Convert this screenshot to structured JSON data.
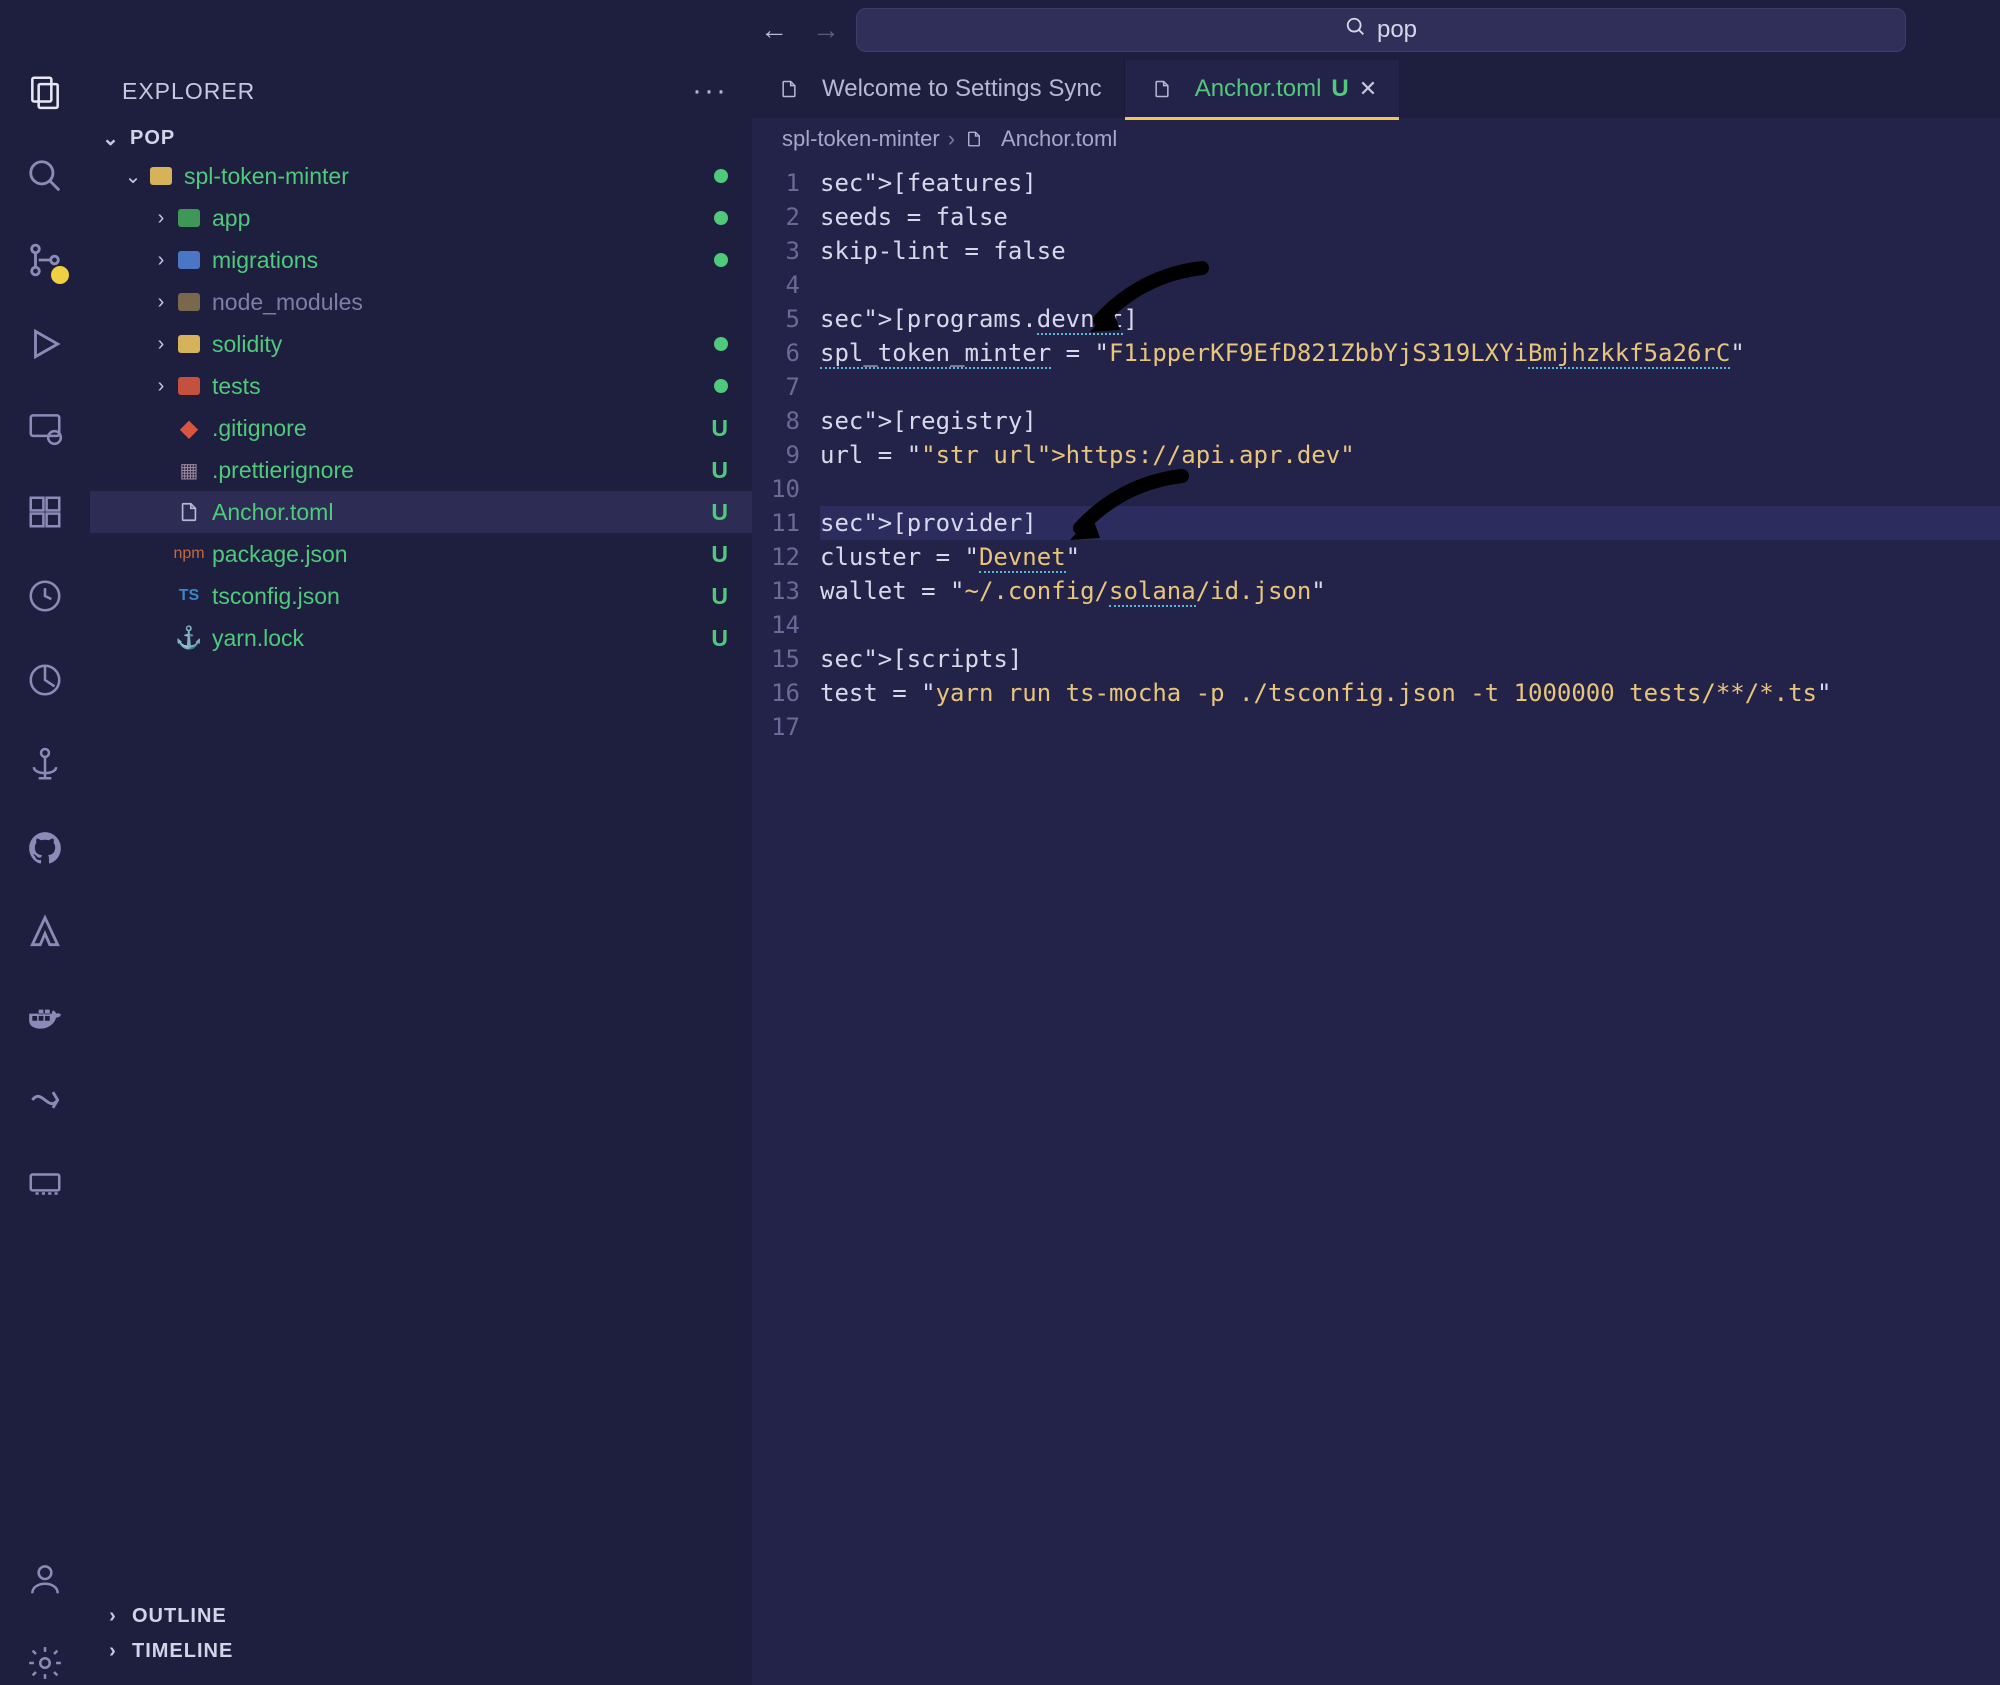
{
  "titlebar": {
    "search_value": "pop"
  },
  "sidebar": {
    "header": "EXPLORER",
    "section": "POP",
    "project": "spl-token-minter",
    "folders": [
      {
        "name": "app",
        "kind": "folder-green",
        "dot": true
      },
      {
        "name": "migrations",
        "kind": "folder-blue",
        "dot": true
      },
      {
        "name": "node_modules",
        "kind": "folder-yellow",
        "muted": true
      },
      {
        "name": "solidity",
        "kind": "folder-yellow",
        "dot": true
      },
      {
        "name": "tests",
        "kind": "folder-red",
        "dot": true
      }
    ],
    "files": [
      {
        "name": ".gitignore",
        "icon": "git",
        "u": true
      },
      {
        "name": ".prettierignore",
        "icon": "prettier",
        "u": true
      },
      {
        "name": "Anchor.toml",
        "icon": "file",
        "u": true,
        "selected": true
      },
      {
        "name": "package.json",
        "icon": "json",
        "u": true
      },
      {
        "name": "tsconfig.json",
        "icon": "ts",
        "u": true
      },
      {
        "name": "yarn.lock",
        "icon": "yarn",
        "u": true
      }
    ],
    "outline": "OUTLINE",
    "timeline": "TIMELINE"
  },
  "tabs": [
    {
      "label": "Welcome to Settings Sync",
      "active": false
    },
    {
      "label": "Anchor.toml",
      "modified": "U",
      "active": true
    }
  ],
  "breadcrumb": {
    "parts": [
      "spl-token-minter",
      "Anchor.toml"
    ]
  },
  "code": {
    "lines": [
      "[features]",
      "seeds = false",
      "skip-lint = false",
      "",
      "[programs.devnet]",
      "spl_token_minter = \"F1ipperKF9EfD821ZbbYjS319LXYiBmjhzkkf5a26rC\"",
      "",
      "[registry]",
      "url = \"https://api.apr.dev\"",
      "",
      "[provider]",
      "cluster = \"Devnet\"",
      "wallet = \"~/.config/solana/id.json\"",
      "",
      "[scripts]",
      "test = \"yarn run ts-mocha -p ./tsconfig.json -t 1000000 tests/**/*.ts\"",
      ""
    ],
    "highlight_line": 11
  }
}
